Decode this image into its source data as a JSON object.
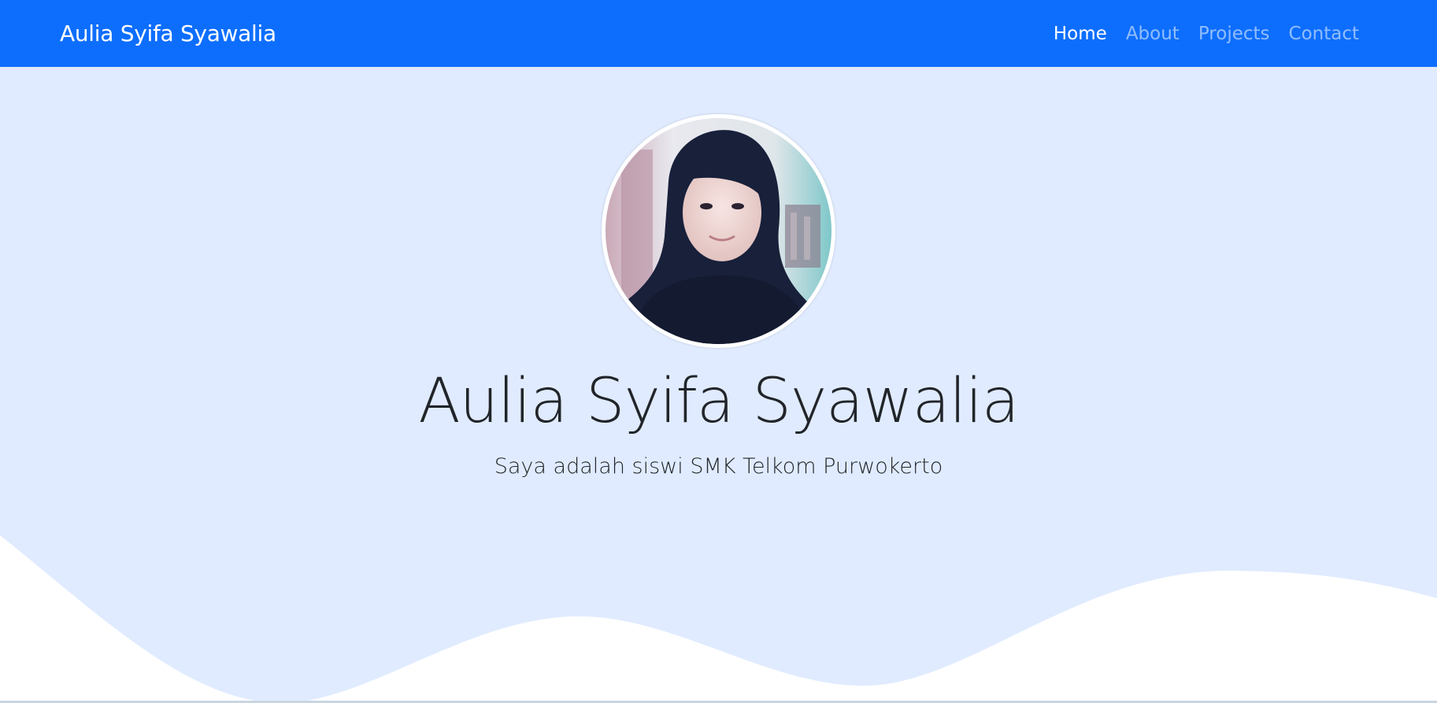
{
  "navbar": {
    "brand": "Aulia Syifa Syawalia",
    "links": [
      {
        "label": "Home",
        "active": true
      },
      {
        "label": "About",
        "active": false
      },
      {
        "label": "Projects",
        "active": false
      },
      {
        "label": "Contact",
        "active": false
      }
    ]
  },
  "hero": {
    "title": "Aulia Syifa Syawalia",
    "subtitle": "Saya adalah siswi SMK Telkom Purwokerto",
    "avatar_icon": "profile-photo"
  },
  "colors": {
    "navbar_bg": "#0d6efd",
    "hero_bg": "#e0ebff",
    "wave_fill": "#ffffff"
  }
}
